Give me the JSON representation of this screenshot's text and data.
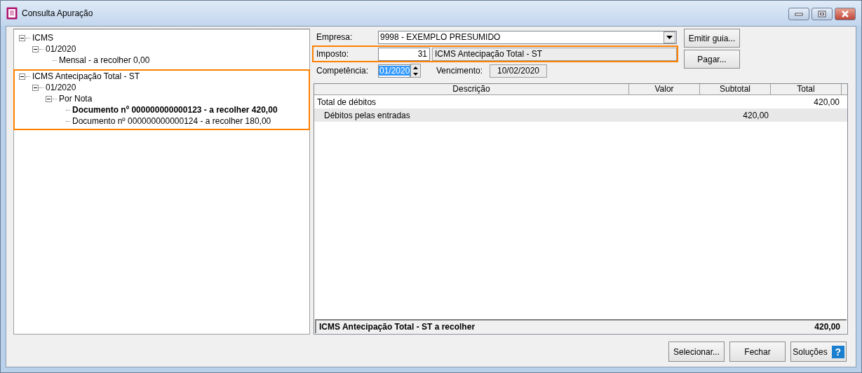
{
  "window": {
    "title": "Consulta Apuração"
  },
  "tree": [
    {
      "label": "ICMS",
      "expanded": true,
      "highlighted": false,
      "selected": false,
      "children": [
        {
          "label": "01/2020",
          "expanded": true,
          "selected": false,
          "children": [
            {
              "label": "Mensal - a recolher 0,00",
              "selected": false
            }
          ]
        }
      ]
    },
    {
      "label": "ICMS Antecipação Total - ST",
      "expanded": true,
      "highlighted": true,
      "selected": false,
      "children": [
        {
          "label": "01/2020",
          "expanded": true,
          "selected": false,
          "children": [
            {
              "label": "Por Nota",
              "expanded": true,
              "selected": false,
              "children": [
                {
                  "label": "Documento nº 000000000000123 - a recolher 420,00",
                  "selected": true
                },
                {
                  "label": "Documento nº 000000000000124 - a recolher 180,00",
                  "selected": false
                }
              ]
            }
          ]
        }
      ]
    }
  ],
  "form": {
    "empresa_label": "Empresa:",
    "empresa_value": "9998 - EXEMPLO PRESUMIDO",
    "imposto_label": "Imposto:",
    "imposto_code": "31",
    "imposto_name": "ICMS Antecipação Total - ST",
    "imposto_highlighted": true,
    "competencia_label": "Competência:",
    "competencia_value": "01/2020",
    "vencimento_label": "Vencimento:",
    "vencimento_value": "10/02/2020"
  },
  "side_buttons": [
    "Emitir guia...",
    "Pagar..."
  ],
  "table": {
    "columns": [
      "Descrição",
      "Valor",
      "Subtotal",
      "Total"
    ],
    "rows": [
      {
        "kind": "group",
        "descricao": "Total de débitos",
        "total": "420,00"
      },
      {
        "kind": "item",
        "descricao": "Débitos pelas entradas",
        "subtotal": "420,00"
      }
    ],
    "footer": {
      "label": "ICMS Antecipação Total - ST a recolher",
      "value": "420,00"
    }
  },
  "buttons": [
    {
      "label": "Selecionar..."
    },
    {
      "label": "Fechar"
    },
    {
      "label": "Soluções",
      "icon": "?"
    }
  ]
}
